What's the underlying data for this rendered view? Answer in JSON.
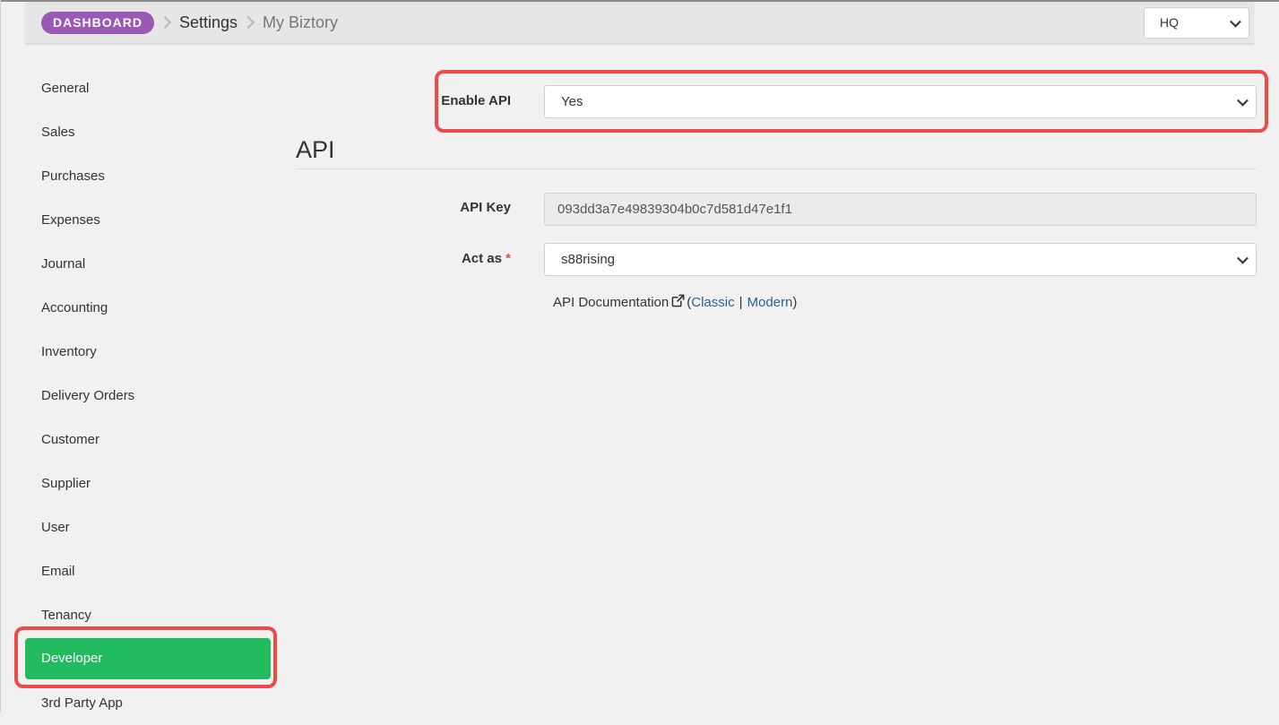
{
  "breadcrumb": {
    "dashboard": "DASHBOARD",
    "settings": "Settings",
    "current": "My Biztory"
  },
  "branch_select": {
    "value": "HQ"
  },
  "sidebar": {
    "items": [
      {
        "label": "General"
      },
      {
        "label": "Sales"
      },
      {
        "label": "Purchases"
      },
      {
        "label": "Expenses"
      },
      {
        "label": "Journal"
      },
      {
        "label": "Accounting"
      },
      {
        "label": "Inventory"
      },
      {
        "label": "Delivery Orders"
      },
      {
        "label": "Customer"
      },
      {
        "label": "Supplier"
      },
      {
        "label": "User"
      },
      {
        "label": "Email"
      },
      {
        "label": "Tenancy"
      },
      {
        "label": "Developer",
        "active": true
      },
      {
        "label": "3rd Party App"
      }
    ]
  },
  "form": {
    "enable_api_label": "Enable API",
    "enable_api_value": "Yes",
    "section_title": "API",
    "api_key_label": "API Key",
    "api_key_value": "093dd3a7e49839304b0c7d581d47e1f1",
    "act_as_label": "Act as",
    "act_as_required": "*",
    "act_as_value": "s88rising",
    "doc_label": "API Documentation",
    "doc_open_paren": "(",
    "doc_classic": "Classic",
    "doc_separator": "|",
    "doc_modern": "Modern",
    "doc_close_paren": ")"
  },
  "colors": {
    "brand_purple": "#9b59b6",
    "active_green": "#22bb5f",
    "highlight_red": "#ef4a4a",
    "link_blue": "#2e5f8a"
  }
}
